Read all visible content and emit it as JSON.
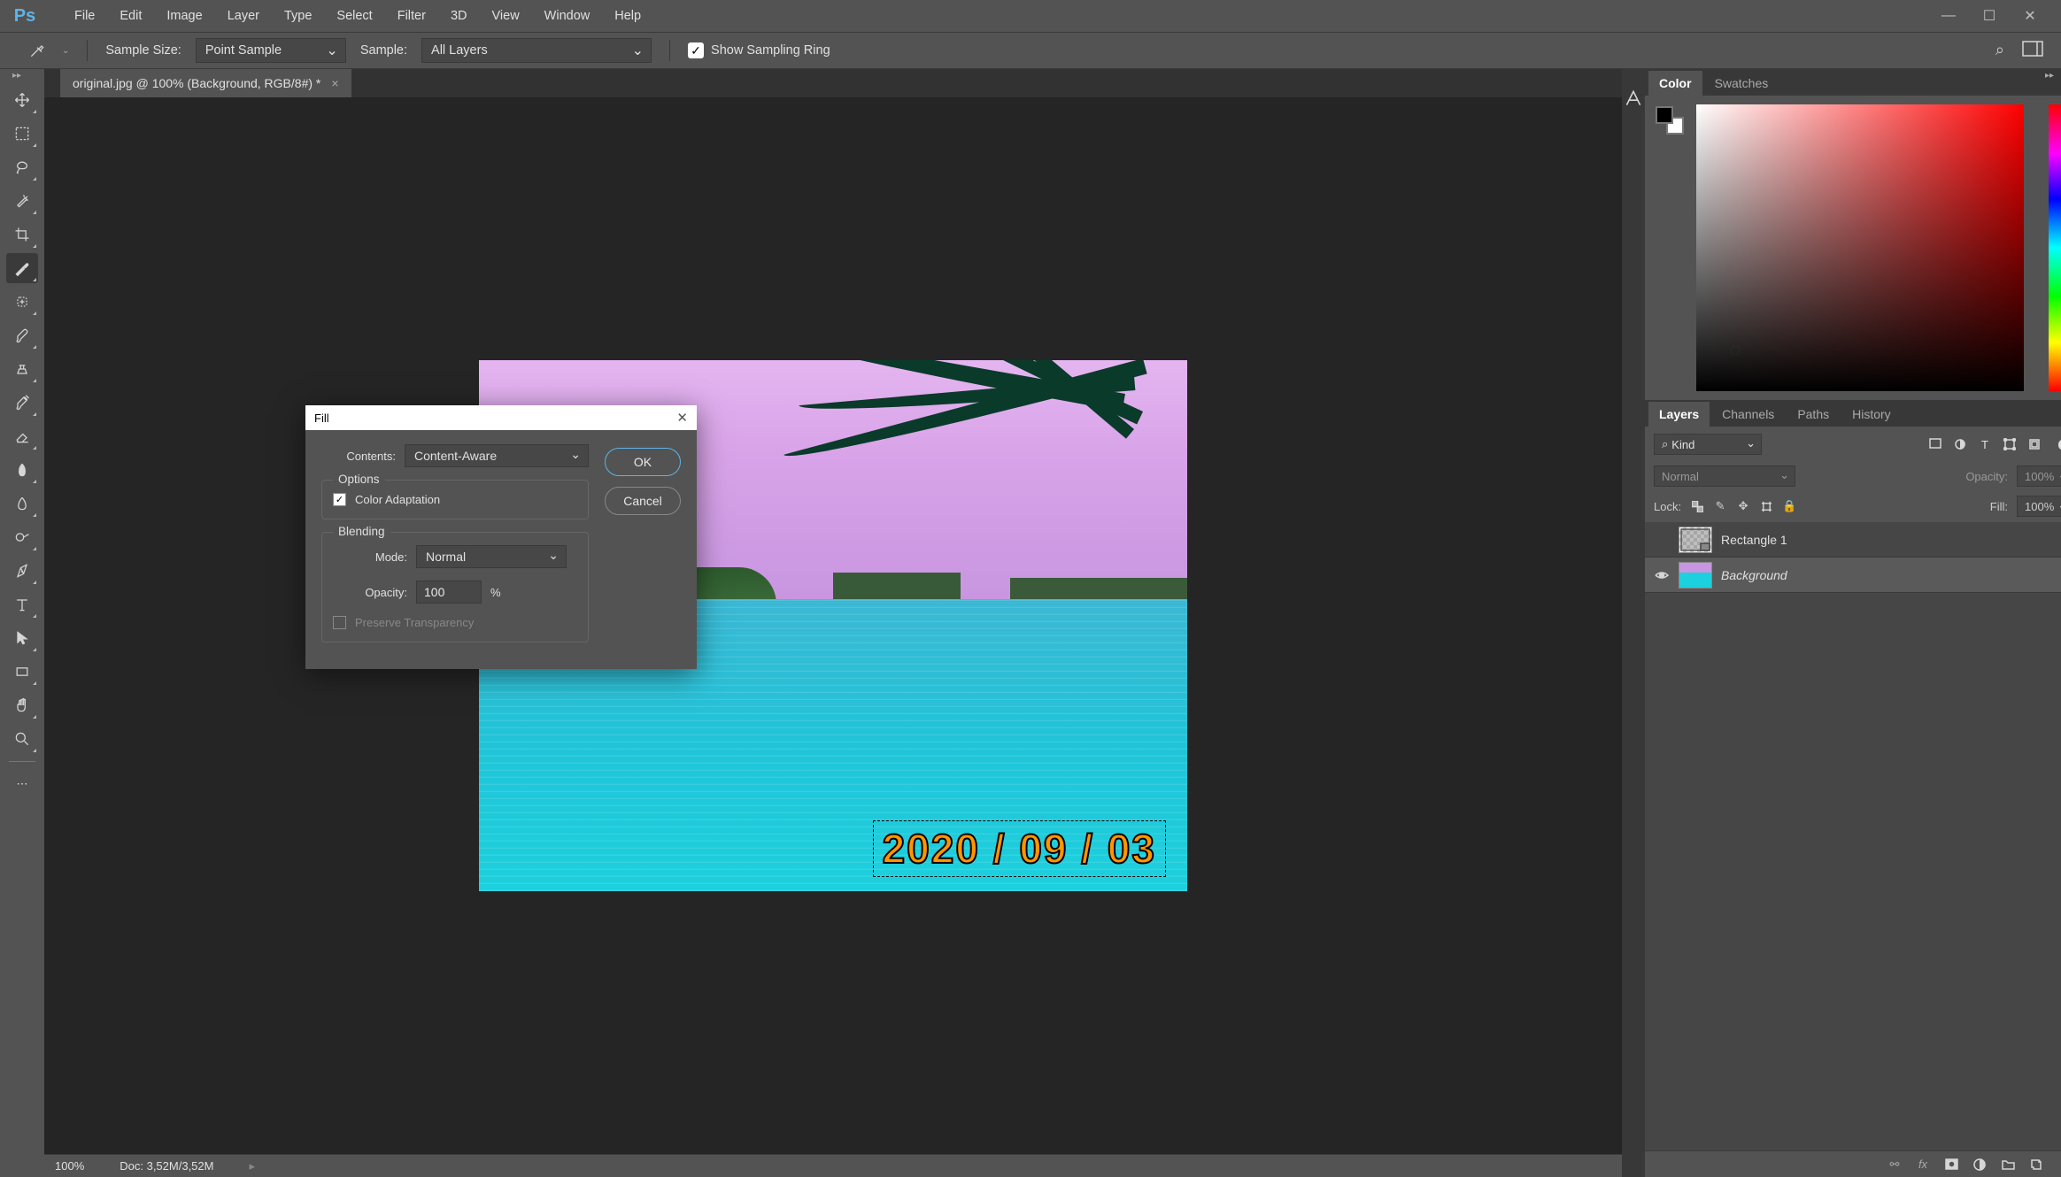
{
  "menubar": [
    "File",
    "Edit",
    "Image",
    "Layer",
    "Type",
    "Select",
    "Filter",
    "3D",
    "View",
    "Window",
    "Help"
  ],
  "optionsbar": {
    "sample_size_label": "Sample Size:",
    "sample_size_value": "Point Sample",
    "sample_label": "Sample:",
    "sample_value": "All Layers",
    "show_sampling_ring": "Show Sampling Ring"
  },
  "document": {
    "tab_title": "original.jpg @ 100% (Background, RGB/8#) *",
    "date_stamp": "2020 / 09 / 03"
  },
  "dialog": {
    "title": "Fill",
    "contents_label": "Contents:",
    "contents_value": "Content-Aware",
    "ok": "OK",
    "cancel": "Cancel",
    "options_legend": "Options",
    "color_adaptation": "Color Adaptation",
    "blending_legend": "Blending",
    "mode_label": "Mode:",
    "mode_value": "Normal",
    "opacity_label": "Opacity:",
    "opacity_value": "100",
    "opacity_unit": "%",
    "preserve_transparency": "Preserve Transparency"
  },
  "statusbar": {
    "zoom": "100%",
    "doc_size": "Doc: 3,52M/3,52M"
  },
  "panels": {
    "color_tabs": [
      "Color",
      "Swatches"
    ],
    "layers_tabs": [
      "Layers",
      "Channels",
      "Paths",
      "History"
    ],
    "layers": {
      "kind_filter": "Kind",
      "blend_mode": "Normal",
      "opacity_label": "Opacity:",
      "opacity_value": "100%",
      "lock_label": "Lock:",
      "fill_label": "Fill:",
      "fill_value": "100%",
      "items": [
        {
          "name": "Rectangle 1",
          "visible": false,
          "locked": false,
          "italic": false,
          "selected": false
        },
        {
          "name": "Background",
          "visible": true,
          "locked": true,
          "italic": true,
          "selected": true
        }
      ]
    }
  },
  "search_placeholder": "🔍"
}
